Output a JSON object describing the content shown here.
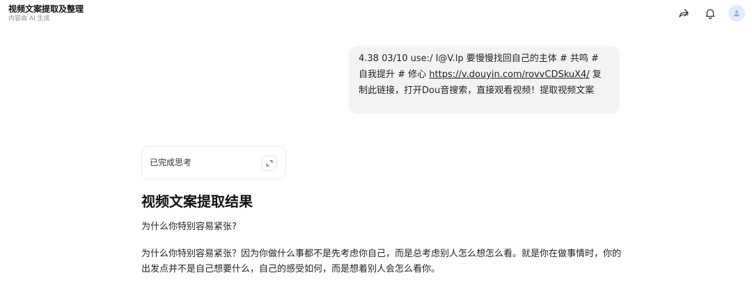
{
  "header": {
    "title": "视频文案提取及整理",
    "subtitle": "内容由 AI 生成",
    "icons": [
      "share-icon",
      "bell-icon",
      "user-avatar-icon"
    ]
  },
  "user_message": {
    "text_before_link": "4.38 03/10 use:/ I@V.lp 要慢慢找回自己的主体 # 共鸣 # 自我提升 # 修心 ",
    "link": "https://v.douyin.com/rovvCDSkuX4/",
    "text_after_link": " 复制此链接，打开Dou音搜索，直接观看视频！提取视频文案"
  },
  "thinking": {
    "label": "已完成思考",
    "expand_icon": "expand-icon"
  },
  "answer": {
    "heading": "视频文案提取结果",
    "subtitle": "为什么你特别容易紧张?",
    "paragraph": "为什么你特别容易紧张？因为你做什么事都不是先考虑你自己，而是总考虑别人怎么想怎么看。就是你在做事情时，你的出发点并不是自己想要什么，自己的感受如何，而是想着别人会怎么看你。"
  },
  "colors": {
    "bubble_bg": "#f3f3f4",
    "avatar_bg": "#e3ecf9",
    "avatar_fg": "#8fb0e0"
  }
}
